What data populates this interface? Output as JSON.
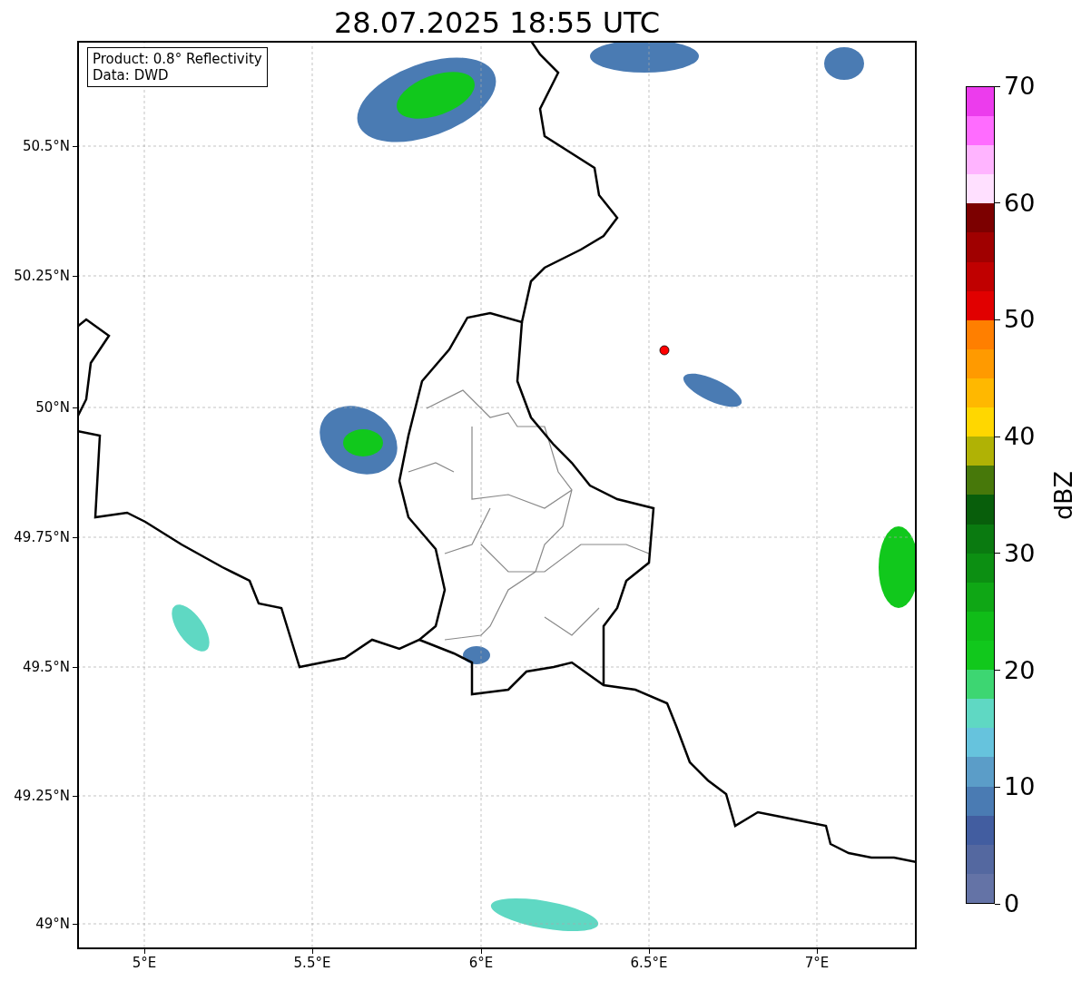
{
  "title": "28.07.2025 18:55 UTC",
  "info_box": [
    "Product: 0.8° Reflectivity",
    "Data: DWD"
  ],
  "map": {
    "lat_labels": [
      "50.5°N",
      "50.25°N",
      "50°N",
      "49.75°N",
      "49.5°N",
      "49.25°N",
      "49°N"
    ],
    "lon_labels": [
      "5°E",
      "5.5°E",
      "6°E",
      "6.5°E",
      "7°E"
    ]
  },
  "colorbar": {
    "label": "dBZ",
    "tick_labels": [
      "70",
      "60",
      "50",
      "40",
      "30",
      "20",
      "10",
      "0"
    ],
    "bands": [
      {
        "color": "#6473a6"
      },
      {
        "color": "#5468a0"
      },
      {
        "color": "#425da0"
      },
      {
        "color": "#4a7bb3"
      },
      {
        "color": "#5b9dc8"
      },
      {
        "color": "#66c3dd"
      },
      {
        "color": "#5fd8c3"
      },
      {
        "color": "#3dd672"
      },
      {
        "color": "#11c81c"
      },
      {
        "color": "#10bd18"
      },
      {
        "color": "#0fa715"
      },
      {
        "color": "#0c8f12"
      },
      {
        "color": "#0a7a10"
      },
      {
        "color": "#085e0b"
      },
      {
        "color": "#47780a"
      },
      {
        "color": "#b0b205"
      },
      {
        "color": "#ffd700"
      },
      {
        "color": "#ffb800"
      },
      {
        "color": "#ff9a00"
      },
      {
        "color": "#ff7f00"
      },
      {
        "color": "#e10000"
      },
      {
        "color": "#c00000"
      },
      {
        "color": "#a00000"
      },
      {
        "color": "#7c0000"
      },
      {
        "color": "#ffe0ff"
      },
      {
        "color": "#ffb4ff"
      },
      {
        "color": "#ff6cff"
      },
      {
        "color": "#ec3ced"
      }
    ]
  }
}
